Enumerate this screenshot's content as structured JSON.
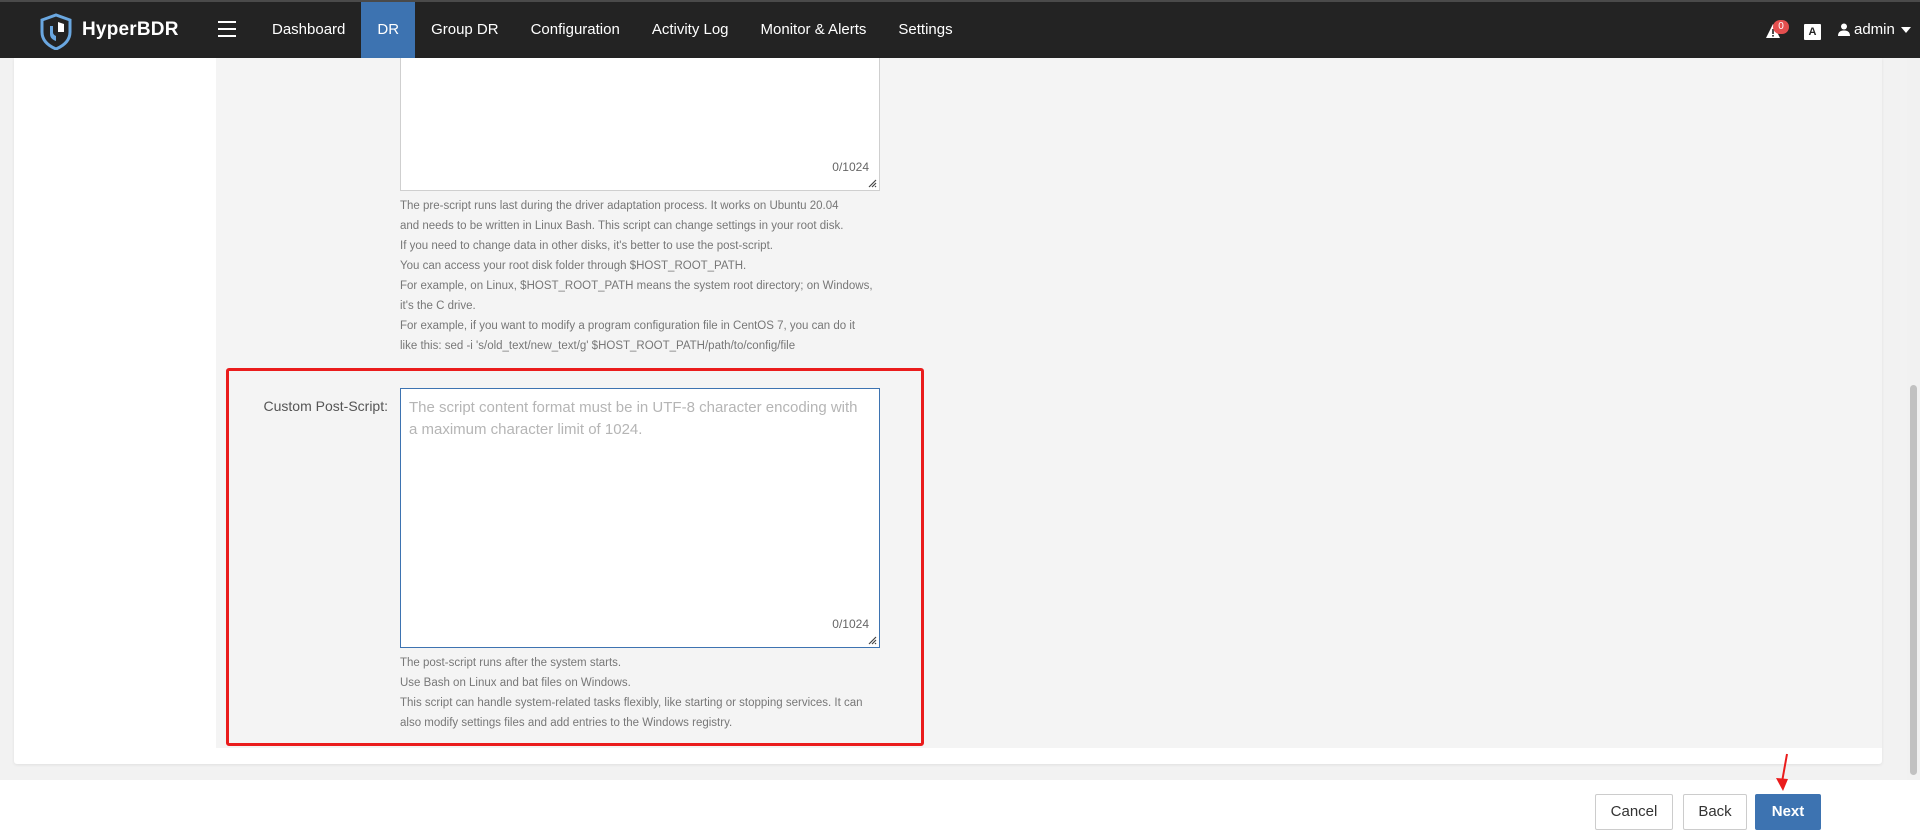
{
  "header": {
    "brand": "HyperBDR",
    "nav": [
      {
        "label": "Dashboard"
      },
      {
        "label": "DR"
      },
      {
        "label": "Group DR"
      },
      {
        "label": "Configuration"
      },
      {
        "label": "Activity Log"
      },
      {
        "label": "Monitor & Alerts"
      },
      {
        "label": "Settings"
      }
    ],
    "active_nav": "DR",
    "alert_count": "0",
    "font_icon_text": "A",
    "user": "admin"
  },
  "pre_script": {
    "counter": "0/1024",
    "help": [
      "The pre-script runs last during the driver adaptation process. It works on Ubuntu 20.04",
      "and needs to be written in Linux Bash. This script can change settings in your root disk.",
      "If you need to change data in other disks, it's better to use the post-script.",
      "You can access your root disk folder through $HOST_ROOT_PATH.",
      "For example, on Linux, $HOST_ROOT_PATH means the system root directory; on Windows,",
      "it's the C drive.",
      "For example, if you want to modify a program configuration file in CentOS 7, you can do it",
      "like this: sed -i 's/old_text/new_text/g' $HOST_ROOT_PATH/path/to/config/file"
    ]
  },
  "post_script": {
    "label": "Custom Post-Script:",
    "placeholder": "The script content format must be in UTF-8 character encoding with a maximum character limit of 1024.",
    "counter": "0/1024",
    "help": [
      "The post-script runs after the system starts.",
      "Use Bash on Linux and bat files on Windows.",
      "This script can handle system-related tasks flexibly, like starting or stopping services. It can",
      "also modify settings files and add entries to the Windows registry."
    ]
  },
  "footer": {
    "cancel": "Cancel",
    "back": "Back",
    "next": "Next"
  },
  "colors": {
    "topbar": "#232323",
    "accent": "#3d73b1",
    "highlight": "#ea1c1c",
    "badge": "#e44f4f"
  }
}
